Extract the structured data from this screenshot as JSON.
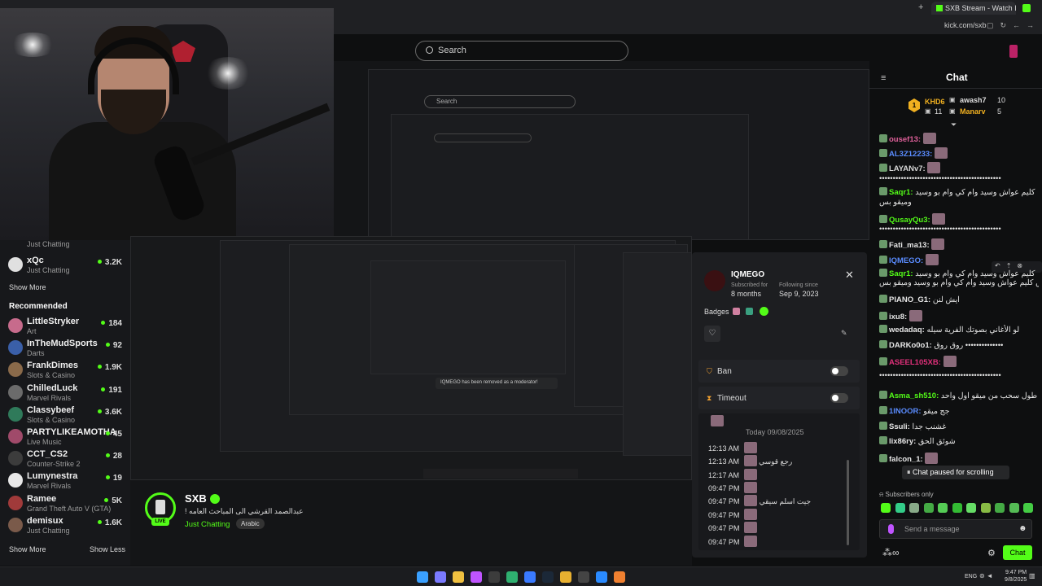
{
  "browser": {
    "tab_title": "SXB Stream - Watch Live on Kick",
    "url": "kick.com/sxb"
  },
  "header": {
    "search_placeholder": "Search"
  },
  "sidebar": {
    "top_partial": {
      "category": "Just Chatting"
    },
    "channels_top": [
      {
        "name": "xQc",
        "category": "Just Chatting",
        "viewers": "3.2K",
        "color": "#e0e0e0"
      }
    ],
    "show_more": "Show More",
    "recommended_title": "Recommended",
    "recommended": [
      {
        "name": "LittleStryker",
        "category": "Art",
        "viewers": "184",
        "color": "#c76b8c"
      },
      {
        "name": "InTheMudSports",
        "category": "Darts",
        "viewers": "92",
        "color": "#3a5fa8"
      },
      {
        "name": "FrankDimes",
        "category": "Slots & Casino",
        "viewers": "1.9K",
        "color": "#8a6a4a"
      },
      {
        "name": "ChilledLuck",
        "category": "Marvel Rivals",
        "viewers": "191",
        "color": "#6b6b6b"
      },
      {
        "name": "Classybeef",
        "category": "Slots & Casino",
        "viewers": "3.6K",
        "color": "#2f7a5a"
      },
      {
        "name": "PARTYLIKEAMOTHA",
        "category": "Live Music",
        "viewers": "45",
        "color": "#a04a6a"
      },
      {
        "name": "CCT_CS2",
        "category": "Counter-Strike 2",
        "viewers": "28",
        "color": "#3c3c3c"
      },
      {
        "name": "Lumynestra",
        "category": "Marvel Rivals",
        "viewers": "19",
        "color": "#e8e8e8"
      },
      {
        "name": "Ramee",
        "category": "Grand Theft Auto V (GTA)",
        "viewers": "5K",
        "color": "#a03a3a"
      },
      {
        "name": "demisux",
        "category": "Just Chatting",
        "viewers": "1.6K",
        "color": "#7a5a4a"
      }
    ],
    "show_more_2": "Show More",
    "show_less": "Show Less"
  },
  "stream_info": {
    "channel": "SXB",
    "title": "! عبدالصمد القرشي الى المباحث العامه",
    "category": "Just Chatting",
    "tag": "Arabic",
    "live": "LIVE",
    "toast": "IQMEGO has been removed as a moderator!"
  },
  "user_card": {
    "username": "IQMEGO",
    "subscribed_label": "Subscribed for",
    "subscribed_value": "8 months",
    "following_label": "Following since",
    "following_value": "Sep 9, 2023",
    "badges_label": "Badges",
    "ban_label": "Ban",
    "timeout_label": "Timeout",
    "history": [
      {
        "time": "",
        "text": ""
      },
      {
        "time": "",
        "text": "Today 09/08/2025"
      },
      {
        "time": "12:13 AM",
        "text": ""
      },
      {
        "time": "12:13 AM",
        "text": "رجع قوسي"
      },
      {
        "time": "12:17 AM",
        "text": ""
      },
      {
        "time": "09:47 PM",
        "text": ""
      },
      {
        "time": "09:47 PM",
        "text": "جيت اسلم سيقي"
      },
      {
        "time": "09:47 PM",
        "text": ""
      },
      {
        "time": "09:47 PM",
        "text": ""
      },
      {
        "time": "09:47 PM",
        "text": ""
      }
    ]
  },
  "chat": {
    "title": "Chat",
    "leaderboard": [
      {
        "rank": "1",
        "name": "KHD6",
        "count": "11"
      },
      {
        "rank": "",
        "name": "awash7",
        "count": "10"
      },
      {
        "rank": "",
        "name": "Manarv",
        "count": "5"
      }
    ],
    "messages": [
      {
        "user": "ousef13:",
        "text": "",
        "color": "#e0609a"
      },
      {
        "user": "AL3Z12233:",
        "text": "",
        "color": "#5a8cff"
      },
      {
        "user": "LAYANv7:",
        "text": "",
        "color": "#d8d8d8"
      },
      {
        "user": "",
        "text": "•••••••••••••••••••••••••••••••••••••••••••••",
        "color": "#ddd"
      },
      {
        "user": "Saqr1:",
        "text": "كليم عواش وسيد وام كي وام بو وسيد",
        "color": "#53fc18"
      },
      {
        "user": "",
        "text": "وميقو بس",
        "color": "#ddd"
      },
      {
        "user": "QusayQu3:",
        "text": "",
        "color": "#53fc18"
      },
      {
        "user": "",
        "text": "•••••••••••••••••••••••••••••••••••••••••••••",
        "color": "#ddd"
      },
      {
        "user": "Fati_ma13:",
        "text": "",
        "color": "#e6e6e6"
      },
      {
        "user": "IQMEGO:",
        "text": "",
        "color": "#5a8cff"
      },
      {
        "user": "Saqr1:",
        "text": "كليم عواش وسيد وام كي وام بو وسيد",
        "color": "#53fc18"
      },
      {
        "user": "",
        "text": "وميقو بس كليم عواش وسيد وام كي وام بو وسيد وميقو بس",
        "color": "#ddd"
      },
      {
        "user": "PIANO_G1:",
        "text": "ايش لنن",
        "color": "#e6e6e6"
      },
      {
        "user": "ixu8:",
        "text": "",
        "color": "#e6e6e6"
      },
      {
        "user": "wedadaq:",
        "text": "لو الأغاني بصوتك الفرية سيله",
        "color": "#e6e6e6"
      },
      {
        "user": "DARKo0o1:",
        "text": "روق روق ••••••••••••••",
        "color": "#e6e6e6"
      },
      {
        "user": "ASEEL105XB:",
        "text": "",
        "color": "#e0307a"
      },
      {
        "user": "",
        "text": "•••••••••••••••••••••••••••••••••••••••••••••",
        "color": "#ddd"
      },
      {
        "user": "Asma_sh510:",
        "text": "اوف على طول سحب من ميقو اول واحد",
        "color": "#53fc18"
      },
      {
        "user": "1INOOR:",
        "text": "جج ميقو",
        "color": "#5a8cff"
      },
      {
        "user": "Ssuli:",
        "text": "غشنب جدا",
        "color": "#e6e6e6"
      },
      {
        "user": "lix86ry:",
        "text": "شوئق الحق",
        "color": "#e6e6e6"
      },
      {
        "user": "falcon_1:",
        "text": "",
        "color": "#e6e6e6"
      }
    ],
    "paused": "Chat paused for scrolling",
    "subscribers_only": "Subscribers only",
    "input_placeholder": "Send a message",
    "send_label": "Chat"
  },
  "taskbar": {
    "lang": "ENG",
    "time": "9:47 PM",
    "date": "9/8/2025"
  },
  "colors": {
    "accent": "#53fc18",
    "bg": "#0e0f10",
    "panel": "#1d1e21"
  }
}
